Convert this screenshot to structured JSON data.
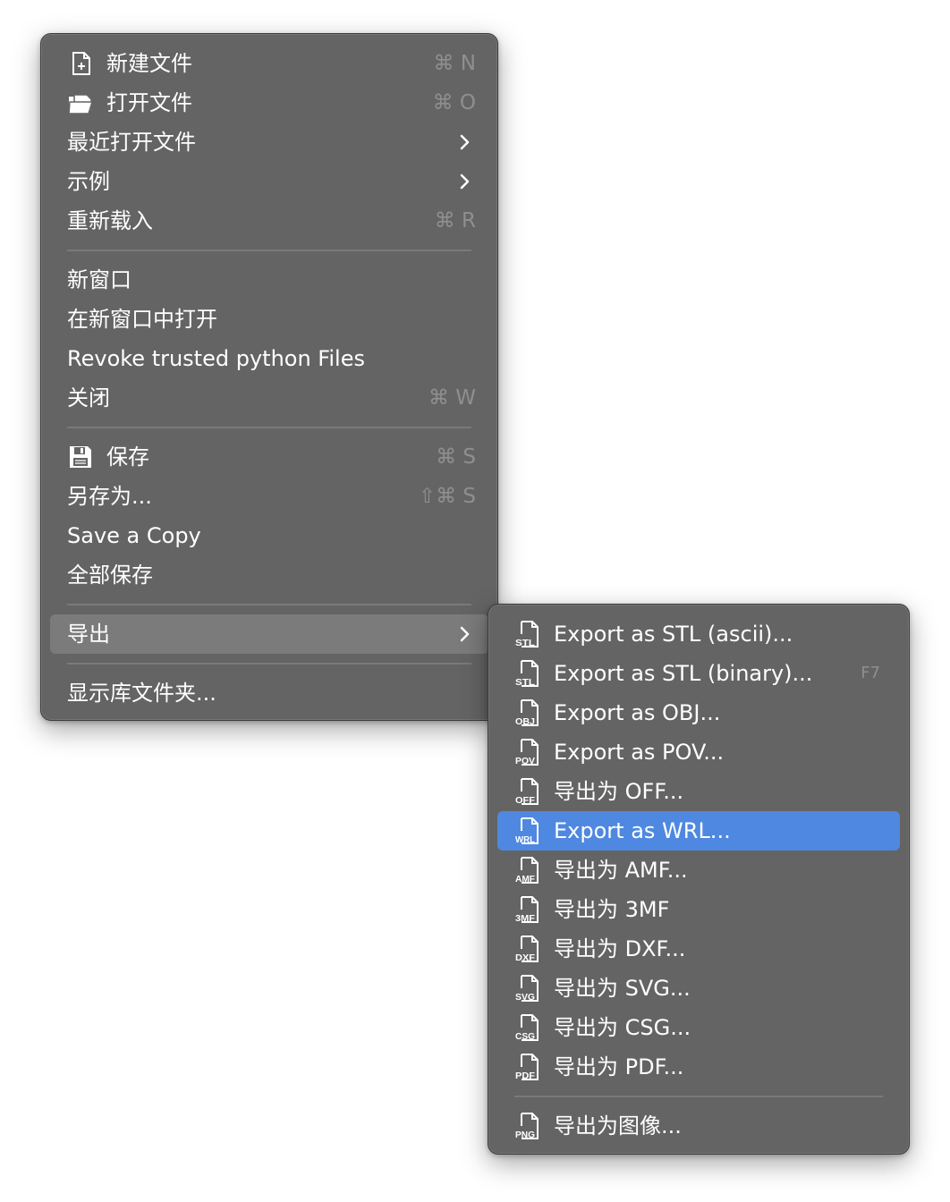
{
  "file_menu": {
    "items": [
      {
        "label": "新建文件",
        "shortcut": "⌘ N",
        "icon": "new-file-icon"
      },
      {
        "label": "打开文件",
        "shortcut": "⌘ O",
        "icon": "open-folder-icon"
      },
      {
        "label": "最近打开文件",
        "submenu": true
      },
      {
        "label": "示例",
        "submenu": true
      },
      {
        "label": "重新载入",
        "shortcut": "⌘ R"
      },
      {
        "label": "新窗口"
      },
      {
        "label": "在新窗口中打开"
      },
      {
        "label": "Revoke trusted python Files"
      },
      {
        "label": "关闭",
        "shortcut": "⌘ W"
      },
      {
        "label": "保存",
        "shortcut": "⌘ S",
        "icon": "save-disk-icon"
      },
      {
        "label": "另存为...",
        "shortcut": "⇧⌘ S"
      },
      {
        "label": "Save a Copy"
      },
      {
        "label": "全部保存"
      },
      {
        "label": "导出",
        "submenu": true,
        "state": "hover"
      },
      {
        "label": "显示库文件夹..."
      }
    ]
  },
  "export_menu": {
    "items": [
      {
        "label": "Export as STL (ascii)...",
        "icon_text": "STL"
      },
      {
        "label": "Export as STL (binary)...",
        "icon_text": "STL",
        "shortcut": "F7"
      },
      {
        "label": "Export as OBJ...",
        "icon_text": "OBJ"
      },
      {
        "label": "Export as POV...",
        "icon_text": "POV"
      },
      {
        "label": "导出为 OFF...",
        "icon_text": "OFF"
      },
      {
        "label": "Export as WRL...",
        "icon_text": "WRL",
        "state": "selected"
      },
      {
        "label": "导出为 AMF...",
        "icon_text": "AMF"
      },
      {
        "label": "导出为 3MF",
        "icon_text": "3MF"
      },
      {
        "label": "导出为 DXF...",
        "icon_text": "DXF"
      },
      {
        "label": "导出为 SVG...",
        "icon_text": "SVG"
      },
      {
        "label": "导出为 CSG...",
        "icon_text": "CSG"
      },
      {
        "label": "导出为 PDF...",
        "icon_text": "PDF"
      },
      {
        "label": "导出为图像...",
        "icon_text": "PNG"
      }
    ]
  },
  "colors": {
    "menu_bg": "#646464",
    "hover_bg": "#7b7b7b",
    "selected_bg": "#4f88e0",
    "shortcut_text": "#8f8f8f",
    "separator": "#7a7a7a"
  }
}
